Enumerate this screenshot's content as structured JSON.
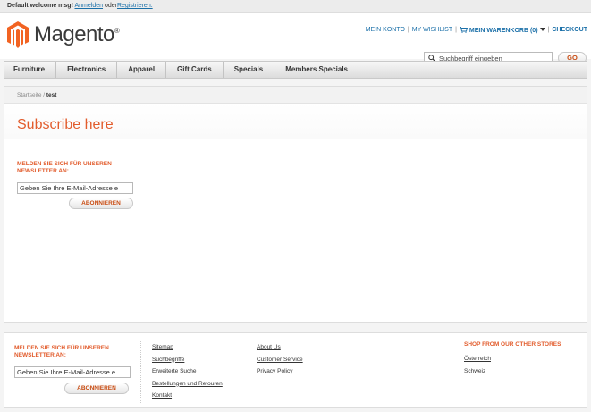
{
  "topbar": {
    "welcome": "Default welcome msg!",
    "login": "Anmelden",
    "or": "oder",
    "register": "Registrieren."
  },
  "header": {
    "logo_text": "Magento",
    "logo_mark": "®",
    "links": {
      "account": "MEIN KONTO",
      "wishlist": "MY WISHLIST",
      "cart": "MEIN WARENKORB (0)",
      "checkout": "CHECKOUT",
      "sep": "|"
    },
    "search": {
      "placeholder": "Suchbegriff eingeben",
      "button": "GO"
    }
  },
  "nav": {
    "items": [
      "Furniture",
      "Electronics",
      "Apparel",
      "Gift Cards",
      "Specials",
      "Members Specials"
    ]
  },
  "breadcrumb": {
    "home": "Startseite",
    "sep": " / ",
    "current": "test"
  },
  "main": {
    "title": "Subscribe here",
    "newsletter": {
      "label": "MELDEN SIE SICH FÜR UNSEREN NEWSLETTER AN:",
      "input_value": "Geben Sie Ihre E-Mail-Adresse e",
      "button": "ABONNIEREN"
    }
  },
  "footer": {
    "newsletter": {
      "label": "MELDEN SIE SICH FÜR UNSEREN NEWSLETTER AN:",
      "input_value": "Geben Sie Ihre E-Mail-Adresse e",
      "button": "ABONNIEREN"
    },
    "col1": [
      "Sitemap",
      "Suchbegriffe",
      "Erweiterte Suche",
      "Bestellungen und Retouren",
      "Kontakt"
    ],
    "col2": [
      "About Us",
      "Customer Service",
      "Privacy Policy"
    ],
    "stores": {
      "heading": "SHOP FROM OUR OTHER STORES",
      "items": [
        "Österreich",
        "Schweiz"
      ]
    }
  },
  "colors": {
    "accent": "#e25c2c",
    "link": "#1a6fa8",
    "logo_orange": "#f26322"
  },
  "icons": [
    "magento-logo-icon",
    "cart-icon",
    "chevron-down-icon",
    "search-icon"
  ]
}
